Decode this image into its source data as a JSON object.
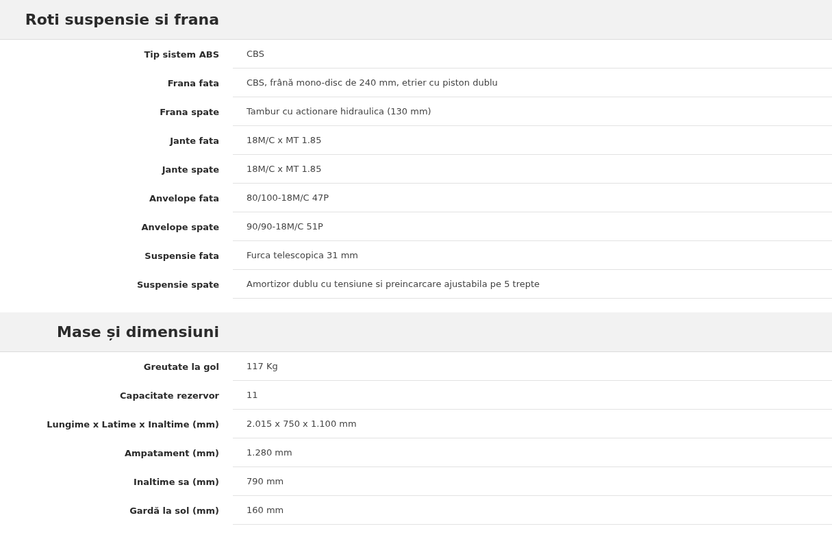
{
  "sections": [
    {
      "title": "Roti suspensie si frana",
      "rows": [
        {
          "label": "Tip sistem ABS",
          "value": "CBS"
        },
        {
          "label": "Frana fata",
          "value": "CBS, frână mono-disc de 240 mm, etrier cu piston dublu"
        },
        {
          "label": "Frana spate",
          "value": "Tambur cu actionare hidraulica (130 mm)"
        },
        {
          "label": "Jante fata",
          "value": "18M/C x MT 1.85"
        },
        {
          "label": "Jante spate",
          "value": "18M/C x MT 1.85"
        },
        {
          "label": "Anvelope fata",
          "value": "80/100-18M/C 47P"
        },
        {
          "label": "Anvelope spate",
          "value": "90/90-18M/C 51P"
        },
        {
          "label": "Suspensie fata",
          "value": "Furca telescopica 31 mm"
        },
        {
          "label": "Suspensie spate",
          "value": "Amortizor dublu cu tensiune si preincarcare ajustabila pe 5 trepte"
        }
      ]
    },
    {
      "title": "Mase și dimensiuni",
      "rows": [
        {
          "label": "Greutate la gol",
          "value": "117 Kg"
        },
        {
          "label": "Capacitate rezervor",
          "value": "11"
        },
        {
          "label": "Lungime x Latime x Inaltime (mm)",
          "value": "2.015 x 750 x 1.100 mm"
        },
        {
          "label": "Ampatament (mm)",
          "value": "1.280 mm"
        },
        {
          "label": "Inaltime sa (mm)",
          "value": "790 mm"
        },
        {
          "label": "Gardă la sol (mm)",
          "value": "160 mm"
        }
      ]
    }
  ]
}
